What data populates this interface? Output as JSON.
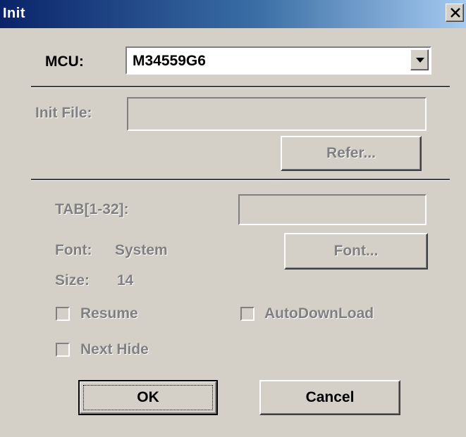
{
  "window": {
    "title": "Init",
    "close_glyph": "×"
  },
  "mcu": {
    "label": "MCU:",
    "selected": "M34559G6"
  },
  "init_file": {
    "label": "Init File:",
    "value": "",
    "refer_button": "Refer..."
  },
  "tab": {
    "label": "TAB[1-32]:",
    "value": ""
  },
  "font": {
    "label": "Font:",
    "value": "System",
    "button": "Font..."
  },
  "size": {
    "label": "Size:",
    "value": "14"
  },
  "options": {
    "resume": {
      "label": "Resume",
      "checked": false
    },
    "auto_download": {
      "label": "AutoDownLoad",
      "checked": false
    },
    "next_hide": {
      "label": "Next Hide",
      "checked": false
    }
  },
  "buttons": {
    "ok": "OK",
    "cancel": "Cancel"
  },
  "colors": {
    "face": "#d4d0c8",
    "title_start": "#0a246a",
    "title_end": "#a6caf0",
    "disabled_text": "#808080"
  },
  "icons": {
    "close": "close-icon",
    "dropdown": "chevron-down-icon"
  }
}
